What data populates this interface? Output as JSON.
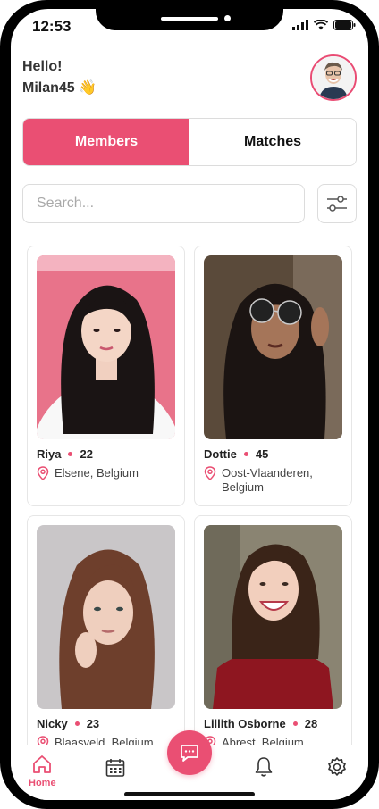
{
  "status_bar": {
    "time": "12:53"
  },
  "header": {
    "greeting": "Hello!",
    "username": "Milan45",
    "wave_emoji": "👋",
    "avatar_icon": "user-avatar"
  },
  "tabs": [
    {
      "label": "Members",
      "active": true
    },
    {
      "label": "Matches",
      "active": false
    }
  ],
  "search": {
    "placeholder": "Search...",
    "value": ""
  },
  "filter_icon": "sliders-icon",
  "members": [
    {
      "name": "Riya",
      "age": "22",
      "location": "Elsene, Belgium"
    },
    {
      "name": "Dottie",
      "age": "45",
      "location": "Oost-Vlaanderen, Belgium"
    },
    {
      "name": "Nicky",
      "age": "23",
      "location": "Blaasveld, Belgium"
    },
    {
      "name": "Lillith Osborne",
      "age": "28",
      "location": "Abrest, Belgium"
    }
  ],
  "bottom_nav": {
    "home_label": "Home",
    "items": [
      "home-icon",
      "calendar-icon",
      "chat-icon",
      "bell-icon",
      "gear-icon"
    ]
  },
  "colors": {
    "accent": "#ea4f73",
    "border": "#dcdcdc"
  }
}
